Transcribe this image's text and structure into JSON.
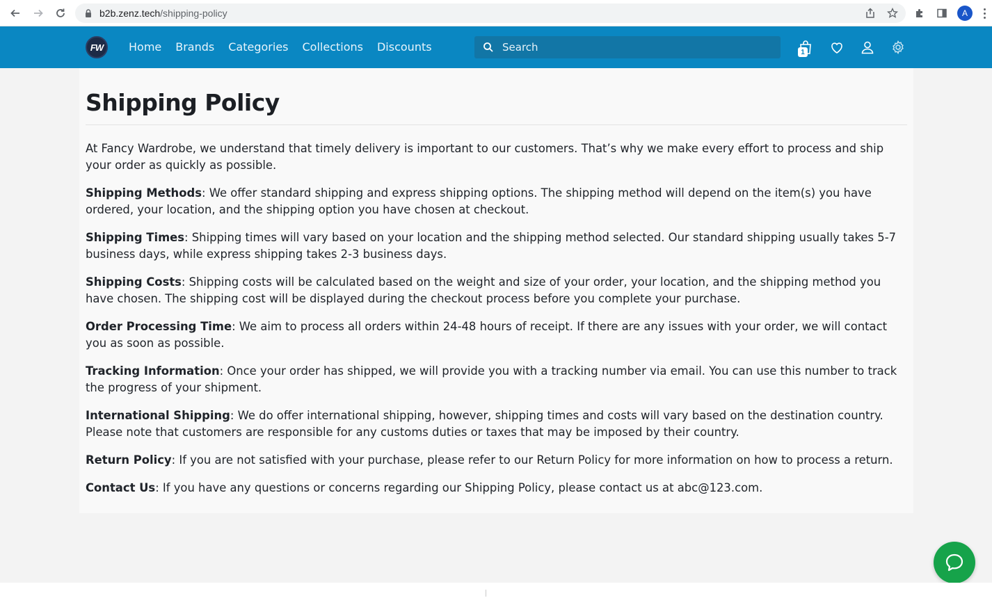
{
  "browser": {
    "url_domain": "b2b.zenz.tech",
    "url_path": "/shipping-policy",
    "profile_initial": "A"
  },
  "header": {
    "logo_text": "FW",
    "nav": [
      "Home",
      "Brands",
      "Categories",
      "Collections",
      "Discounts"
    ],
    "search_placeholder": "Search",
    "cart_count": "1",
    "colors": {
      "header_bg": "#0a87c2",
      "chat_button": "#16a34a"
    },
    "icons": [
      "cart-icon",
      "heart-icon",
      "user-icon",
      "settings-icon"
    ]
  },
  "page": {
    "title": "Shipping Policy",
    "intro": "At Fancy Wardrobe, we understand that timely delivery is important to our customers. That’s why we make every effort to process and ship your order as quickly as possible.",
    "sections": [
      {
        "heading": "Shipping Methods",
        "text": ": We offer standard shipping and express shipping options. The shipping method will depend on the item(s) you have ordered, your location, and the shipping option you have chosen at checkout."
      },
      {
        "heading": "Shipping Times",
        "text": ": Shipping times will vary based on your location and the shipping method selected. Our standard shipping usually takes 5-7 business days, while express shipping takes 2-3 business days."
      },
      {
        "heading": "Shipping Costs",
        "text": ": Shipping costs will be calculated based on the weight and size of your order, your location, and the shipping method you have chosen. The shipping cost will be displayed during the checkout process before you complete your purchase."
      },
      {
        "heading": "Order Processing Time",
        "text": ": We aim to process all orders within 24-48 hours of receipt. If there are any issues with your order, we will contact you as soon as possible."
      },
      {
        "heading": "Tracking Information",
        "text": ": Once your order has shipped, we will provide you with a tracking number via email. You can use this number to track the progress of your shipment."
      },
      {
        "heading": "International Shipping",
        "text": ": We do offer international shipping, however, shipping times and costs will vary based on the destination country. Please note that customers are responsible for any customs duties or taxes that may be imposed by their country."
      },
      {
        "heading": "Return Policy",
        "text": ": If you are not satisfied with your purchase, please refer to our Return Policy for more information on how to process a return."
      },
      {
        "heading": "Contact Us",
        "text": ": If you have any questions or concerns regarding our Shipping Policy, please contact us at abc@123.com."
      }
    ]
  }
}
